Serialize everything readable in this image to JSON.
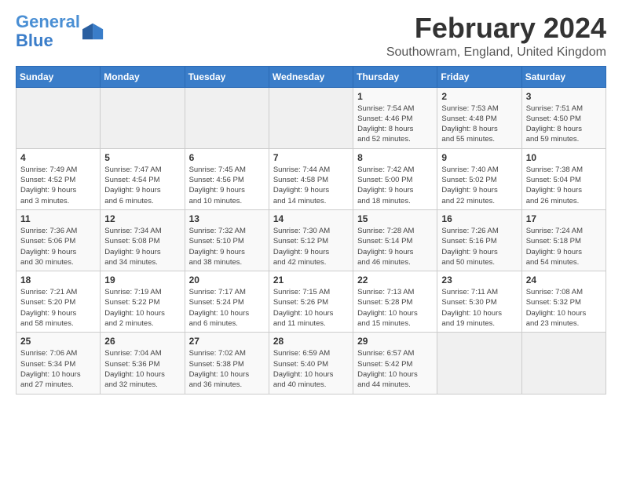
{
  "logo": {
    "line1": "General",
    "line2": "Blue"
  },
  "header": {
    "month": "February 2024",
    "location": "Southowram, England, United Kingdom"
  },
  "weekdays": [
    "Sunday",
    "Monday",
    "Tuesday",
    "Wednesday",
    "Thursday",
    "Friday",
    "Saturday"
  ],
  "weeks": [
    [
      {
        "day": "",
        "info": ""
      },
      {
        "day": "",
        "info": ""
      },
      {
        "day": "",
        "info": ""
      },
      {
        "day": "",
        "info": ""
      },
      {
        "day": "1",
        "info": "Sunrise: 7:54 AM\nSunset: 4:46 PM\nDaylight: 8 hours\nand 52 minutes."
      },
      {
        "day": "2",
        "info": "Sunrise: 7:53 AM\nSunset: 4:48 PM\nDaylight: 8 hours\nand 55 minutes."
      },
      {
        "day": "3",
        "info": "Sunrise: 7:51 AM\nSunset: 4:50 PM\nDaylight: 8 hours\nand 59 minutes."
      }
    ],
    [
      {
        "day": "4",
        "info": "Sunrise: 7:49 AM\nSunset: 4:52 PM\nDaylight: 9 hours\nand 3 minutes."
      },
      {
        "day": "5",
        "info": "Sunrise: 7:47 AM\nSunset: 4:54 PM\nDaylight: 9 hours\nand 6 minutes."
      },
      {
        "day": "6",
        "info": "Sunrise: 7:45 AM\nSunset: 4:56 PM\nDaylight: 9 hours\nand 10 minutes."
      },
      {
        "day": "7",
        "info": "Sunrise: 7:44 AM\nSunset: 4:58 PM\nDaylight: 9 hours\nand 14 minutes."
      },
      {
        "day": "8",
        "info": "Sunrise: 7:42 AM\nSunset: 5:00 PM\nDaylight: 9 hours\nand 18 minutes."
      },
      {
        "day": "9",
        "info": "Sunrise: 7:40 AM\nSunset: 5:02 PM\nDaylight: 9 hours\nand 22 minutes."
      },
      {
        "day": "10",
        "info": "Sunrise: 7:38 AM\nSunset: 5:04 PM\nDaylight: 9 hours\nand 26 minutes."
      }
    ],
    [
      {
        "day": "11",
        "info": "Sunrise: 7:36 AM\nSunset: 5:06 PM\nDaylight: 9 hours\nand 30 minutes."
      },
      {
        "day": "12",
        "info": "Sunrise: 7:34 AM\nSunset: 5:08 PM\nDaylight: 9 hours\nand 34 minutes."
      },
      {
        "day": "13",
        "info": "Sunrise: 7:32 AM\nSunset: 5:10 PM\nDaylight: 9 hours\nand 38 minutes."
      },
      {
        "day": "14",
        "info": "Sunrise: 7:30 AM\nSunset: 5:12 PM\nDaylight: 9 hours\nand 42 minutes."
      },
      {
        "day": "15",
        "info": "Sunrise: 7:28 AM\nSunset: 5:14 PM\nDaylight: 9 hours\nand 46 minutes."
      },
      {
        "day": "16",
        "info": "Sunrise: 7:26 AM\nSunset: 5:16 PM\nDaylight: 9 hours\nand 50 minutes."
      },
      {
        "day": "17",
        "info": "Sunrise: 7:24 AM\nSunset: 5:18 PM\nDaylight: 9 hours\nand 54 minutes."
      }
    ],
    [
      {
        "day": "18",
        "info": "Sunrise: 7:21 AM\nSunset: 5:20 PM\nDaylight: 9 hours\nand 58 minutes."
      },
      {
        "day": "19",
        "info": "Sunrise: 7:19 AM\nSunset: 5:22 PM\nDaylight: 10 hours\nand 2 minutes."
      },
      {
        "day": "20",
        "info": "Sunrise: 7:17 AM\nSunset: 5:24 PM\nDaylight: 10 hours\nand 6 minutes."
      },
      {
        "day": "21",
        "info": "Sunrise: 7:15 AM\nSunset: 5:26 PM\nDaylight: 10 hours\nand 11 minutes."
      },
      {
        "day": "22",
        "info": "Sunrise: 7:13 AM\nSunset: 5:28 PM\nDaylight: 10 hours\nand 15 minutes."
      },
      {
        "day": "23",
        "info": "Sunrise: 7:11 AM\nSunset: 5:30 PM\nDaylight: 10 hours\nand 19 minutes."
      },
      {
        "day": "24",
        "info": "Sunrise: 7:08 AM\nSunset: 5:32 PM\nDaylight: 10 hours\nand 23 minutes."
      }
    ],
    [
      {
        "day": "25",
        "info": "Sunrise: 7:06 AM\nSunset: 5:34 PM\nDaylight: 10 hours\nand 27 minutes."
      },
      {
        "day": "26",
        "info": "Sunrise: 7:04 AM\nSunset: 5:36 PM\nDaylight: 10 hours\nand 32 minutes."
      },
      {
        "day": "27",
        "info": "Sunrise: 7:02 AM\nSunset: 5:38 PM\nDaylight: 10 hours\nand 36 minutes."
      },
      {
        "day": "28",
        "info": "Sunrise: 6:59 AM\nSunset: 5:40 PM\nDaylight: 10 hours\nand 40 minutes."
      },
      {
        "day": "29",
        "info": "Sunrise: 6:57 AM\nSunset: 5:42 PM\nDaylight: 10 hours\nand 44 minutes."
      },
      {
        "day": "",
        "info": ""
      },
      {
        "day": "",
        "info": ""
      }
    ]
  ]
}
